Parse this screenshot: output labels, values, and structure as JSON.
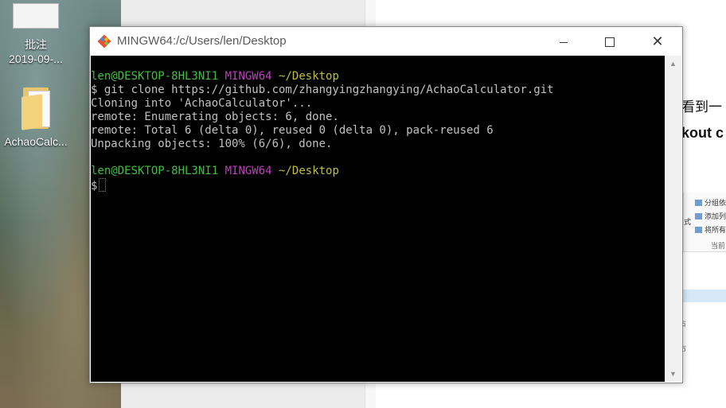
{
  "desktop": {
    "icons": [
      {
        "label_line1": "批注",
        "label_line2": "2019-09-..."
      },
      {
        "label_line1": "AchaoCalc..."
      }
    ]
  },
  "background_doc": {
    "text_line1": "看到一",
    "text_line2": "kout c",
    "ribbon_items": [
      "分组依",
      "添加列",
      "将所有"
    ],
    "ribbon_format": "式",
    "ribbon_current": "当前",
    "side_glyph_1": "占",
    "side_glyph_2": "市"
  },
  "window": {
    "title": "MINGW64:/c/Users/len/Desktop",
    "controls": {
      "minimize": "minimize",
      "maximize": "maximize",
      "close": "✕"
    }
  },
  "terminal": {
    "prompt1": {
      "user": "len@DESKTOP-8HL3NI1",
      "host": "MINGW64",
      "path": "~/Desktop"
    },
    "command": "$ git clone https://github.com/zhangyingzhangying/AchaoCalculator.git",
    "output": [
      "Cloning into 'AchaoCalculator'...",
      "remote: Enumerating objects: 6, done.",
      "remote: Total 6 (delta 0), reused 0 (delta 0), pack-reused 6",
      "Unpacking objects: 100% (6/6), done."
    ],
    "prompt2": {
      "user": "len@DESKTOP-8HL3NI1",
      "host": "MINGW64",
      "path": "~/Desktop"
    },
    "input_prompt": "$"
  },
  "colors": {
    "user": "#3fbf3f",
    "host": "#bf3fbf",
    "path": "#bfbf3f",
    "console_bg": "#000000",
    "console_text": "#c0c0c0"
  }
}
